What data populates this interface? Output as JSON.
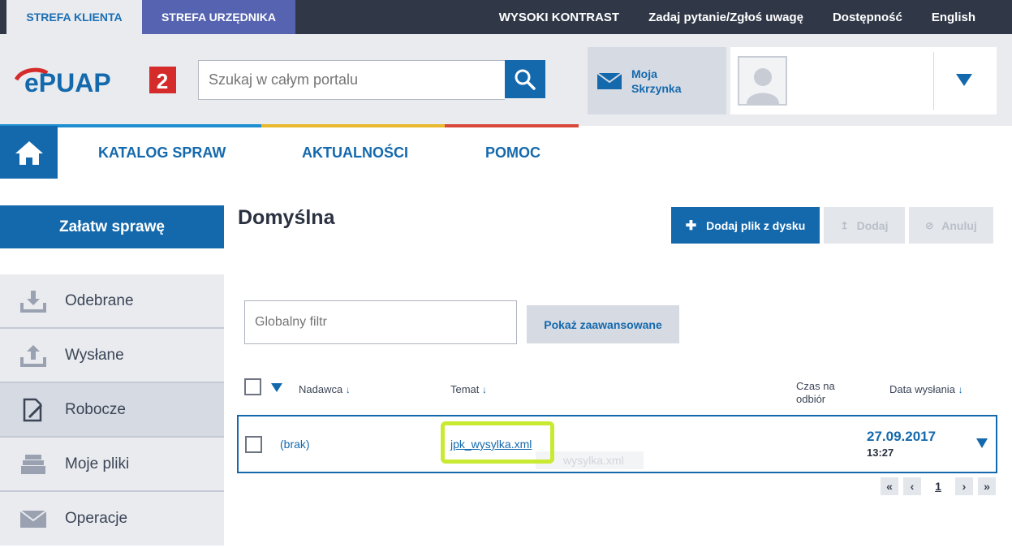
{
  "topbar": {
    "tab_klient": "STREFA KLIENTA",
    "tab_urzednik": "STREFA URZĘDNIKA",
    "links": [
      "WYSOKI KONTRAST",
      "Zadaj pytanie/Zgłoś uwagę",
      "Dostępność",
      "English"
    ]
  },
  "header": {
    "logo_text": "ePUAP",
    "logo_badge": "2",
    "search_placeholder": "Szukaj w całym portalu",
    "mailbox_label": "Moja Skrzynka"
  },
  "nav": {
    "items": [
      "KATALOG SPRAW",
      "AKTUALNOŚCI",
      "POMOC"
    ]
  },
  "sidebar": {
    "cta": "Załatw sprawę",
    "items": [
      {
        "label": "Odebrane",
        "icon": "download-tray-icon"
      },
      {
        "label": "Wysłane",
        "icon": "upload-tray-icon"
      },
      {
        "label": "Robocze",
        "icon": "edit-document-icon",
        "active": true
      },
      {
        "label": "Moje pliki",
        "icon": "file-stack-icon"
      },
      {
        "label": "Operacje",
        "icon": "envelope-icon"
      }
    ]
  },
  "main": {
    "title": "Domyślna",
    "btn_add_file": "Dodaj plik z dysku",
    "btn_add": "Dodaj",
    "btn_cancel": "Anuluj",
    "filter_placeholder": "Globalny filtr",
    "btn_advanced": "Pokaż zaawansowane",
    "table": {
      "headers": {
        "sender": "Nadawca",
        "subject": "Temat",
        "pickup_time": "Czas na odbiór",
        "sent_date": "Data wysłania"
      },
      "rows": [
        {
          "sender": "(brak)",
          "subject": "jpk_wysylka.xml",
          "ghost": "wysylka.xml",
          "date": "27.09.2017",
          "time": "13:27"
        }
      ]
    },
    "pagination": {
      "first": "«",
      "prev": "‹",
      "page": "1",
      "next": "›",
      "last": "»"
    }
  },
  "colors": {
    "brand_blue": "#1469ad",
    "topbar_bg": "#303848",
    "highlight": "#c8ea33",
    "nav_stripe_blue": "#1d8fd0",
    "nav_stripe_yellow": "#e8b92c",
    "nav_stripe_red": "#d9483b"
  }
}
